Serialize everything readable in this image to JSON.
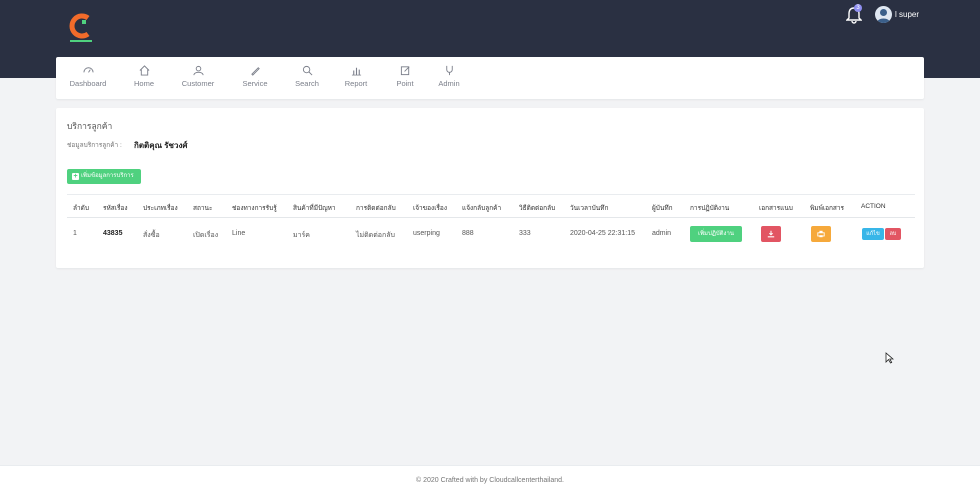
{
  "header": {
    "user_name": "l super",
    "notification_count": "3",
    "logo_icon": "logo-c-icon",
    "bell_icon": "bell-icon"
  },
  "nav": {
    "items": [
      {
        "label": "Dashboard",
        "icon": "dashboard-icon"
      },
      {
        "label": "Home",
        "icon": "home-icon"
      },
      {
        "label": "Customer",
        "icon": "user-icon"
      },
      {
        "label": "Service",
        "icon": "pen-icon"
      },
      {
        "label": "Search",
        "icon": "search-icon"
      },
      {
        "label": "Report",
        "icon": "bar-chart-icon"
      },
      {
        "label": "Point",
        "icon": "edit-icon"
      },
      {
        "label": "Admin",
        "icon": "stethoscope-icon"
      }
    ]
  },
  "main": {
    "title": "บริการลูกค้า",
    "info_label": "ช่อมูลบริการลูกค้า :",
    "info_value": "กิตติคุณ รัชวงศ์",
    "add_button": "เพิ่มข้อมูลการบริการ",
    "table": {
      "headers": [
        "ลำดับ",
        "รหัสเรื่อง",
        "ประเภทเรื่อง",
        "สถานะ",
        "ช่องทางการรับรู้",
        "สินค้าที่มีปัญหา",
        "การติดต่อกลับ",
        "เจ้าของเรื่อง",
        "แจ้งกลับลูกค้า",
        "วิธีติดต่อกลับ",
        "วันเวลาบันทึก",
        "ผู้บันทึก",
        "การปฏิบัติงาน",
        "เอกสารแนบ",
        "พิมพ์เอกสาร",
        "ACTION"
      ],
      "row": {
        "no": "1",
        "case_id": "43835",
        "type": "สั่งซื้อ",
        "status": "เปิดเรื่อง",
        "channel": "Line",
        "product": "มาร์ค",
        "callback": "ไม่ติดต่อกลับ",
        "owner": "userping",
        "notify": "888",
        "method": "333",
        "datetime": "2020-04-25 22:31:15",
        "recorder": "admin",
        "action_button": "เพิ่มปฏิบัติงาน",
        "download_icon": "download-icon",
        "print_icon": "print-icon",
        "edit_button": "แก้ไข",
        "delete_button": "ลบ"
      }
    }
  },
  "footer": {
    "text": "© 2020 Crafted with by Cloudcallcenterthailand."
  },
  "colors": {
    "topbar": "#2a3042",
    "green": "#4fd17f",
    "red": "#e25563",
    "orange": "#f6a93b",
    "blue": "#38b6e8"
  }
}
